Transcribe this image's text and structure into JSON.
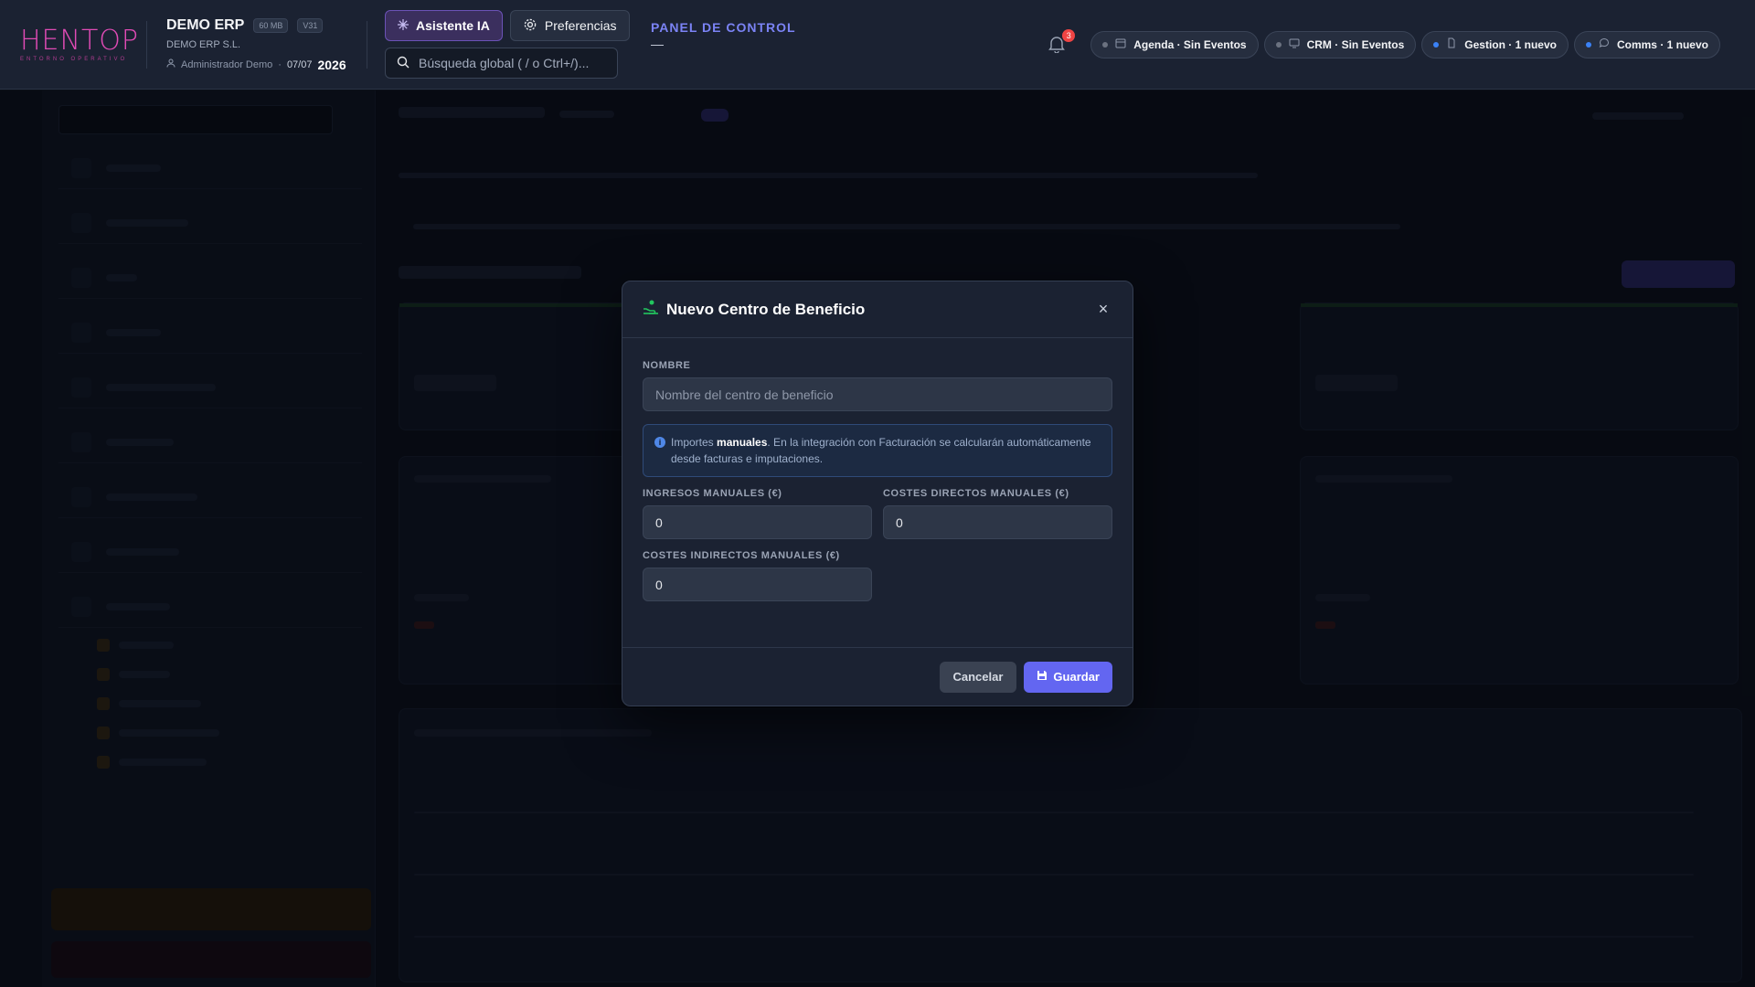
{
  "header": {
    "logo_text": "HENTOP",
    "logo_subtitle": "ENTORNO OPERATIVO",
    "company_name": "DEMO ERP",
    "storage_badge": "60 MB",
    "version_badge": "V31",
    "company_legal": "DEMO ERP S.L.",
    "user_name": "Administrador Demo",
    "date": "07/07",
    "year": "2026",
    "ai_button": "Asistente IA",
    "preferences_button": "Preferencias",
    "search_placeholder": "Búsqueda global ( / o Ctrl+/)...",
    "panel_title": "PANEL DE CONTROL",
    "panel_subtitle": "—",
    "notification_count": "3",
    "status_pills": [
      {
        "label": "Agenda · Sin Eventos",
        "icon": "calendar-icon",
        "dot": "#6b7280"
      },
      {
        "label": "CRM · Sin Eventos",
        "icon": "monitor-icon",
        "dot": "#6b7280"
      },
      {
        "label": "Gestion · 1 nuevo",
        "icon": "document-icon",
        "dot": "#3b82f6"
      },
      {
        "label": "Comms · 1 nuevo",
        "icon": "chat-icon",
        "dot": "#3b82f6"
      }
    ]
  },
  "modal": {
    "title": "Nuevo Centro de Beneficio",
    "close_label": "×",
    "name_label": "NOMBRE",
    "name_placeholder": "Nombre del centro de beneficio",
    "name_value": "",
    "info_prefix": "Importes",
    "info_bold": "manuales",
    "info_rest": ". En la integración con Facturación se calcularán automáticamente desde facturas e imputaciones.",
    "income_label": "INGRESOS MANUALES (€)",
    "income_value": "0",
    "direct_costs_label": "COSTES DIRECTOS MANUALES (€)",
    "direct_costs_value": "0",
    "indirect_costs_label": "COSTES INDIRECTOS MANUALES (€)",
    "indirect_costs_value": "0",
    "cancel_button": "Cancelar",
    "save_button": "Guardar"
  },
  "colors": {
    "accent": "#6366f1",
    "brand": "#e04bb5",
    "panel_title": "#7b83f5",
    "info_border": "#2f4a78"
  }
}
